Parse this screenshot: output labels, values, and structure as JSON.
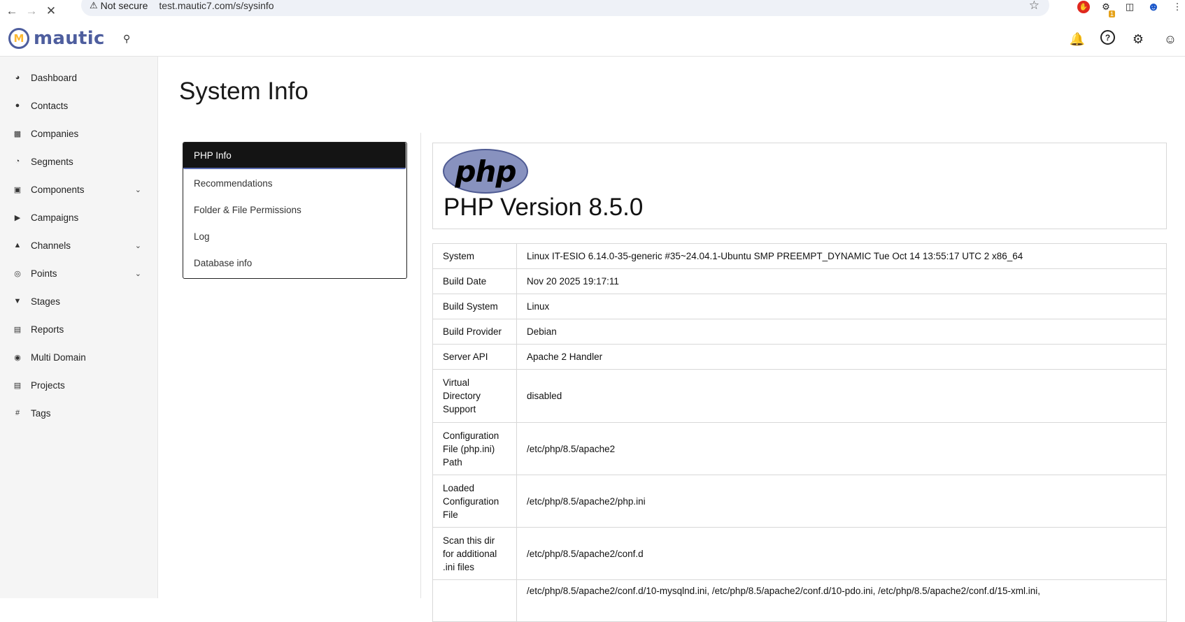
{
  "browser": {
    "security_label": "Not secure",
    "url": "test.mautic7.com/s/sysinfo",
    "ext_badge": "1"
  },
  "header": {
    "logo_text": "mautic",
    "logo_mark": "M"
  },
  "sidebar": {
    "items": [
      {
        "label": "Dashboard",
        "icon": "dashboard-icon"
      },
      {
        "label": "Contacts",
        "icon": "user-icon"
      },
      {
        "label": "Companies",
        "icon": "building-icon"
      },
      {
        "label": "Segments",
        "icon": "pie-chart-icon"
      },
      {
        "label": "Components",
        "icon": "archive-icon",
        "expandable": true
      },
      {
        "label": "Campaigns",
        "icon": "megaphone-icon"
      },
      {
        "label": "Channels",
        "icon": "broadcast-icon",
        "expandable": true
      },
      {
        "label": "Points",
        "icon": "coins-icon",
        "expandable": true
      },
      {
        "label": "Stages",
        "icon": "filter-icon"
      },
      {
        "label": "Reports",
        "icon": "report-icon"
      },
      {
        "label": "Multi Domain",
        "icon": "globe-icon"
      },
      {
        "label": "Projects",
        "icon": "box-icon"
      },
      {
        "label": "Tags",
        "icon": "hash-icon"
      }
    ]
  },
  "main": {
    "title": "System Info",
    "tabs": [
      {
        "label": "PHP Info",
        "active": true
      },
      {
        "label": "Recommendations"
      },
      {
        "label": "Folder & File Permissions"
      },
      {
        "label": "Log"
      },
      {
        "label": "Database info"
      }
    ],
    "php": {
      "logo_text": "php",
      "version": "PHP Version 8.5.0"
    },
    "info_rows": [
      {
        "key": "System",
        "value": "Linux IT-ESIO 6.14.0-35-generic #35~24.04.1-Ubuntu SMP PREEMPT_DYNAMIC Tue Oct 14 13:55:17 UTC 2 x86_64"
      },
      {
        "key": "Build Date",
        "value": "Nov 20 2025 19:17:11"
      },
      {
        "key": "Build System",
        "value": "Linux"
      },
      {
        "key": "Build Provider",
        "value": "Debian"
      },
      {
        "key": "Server API",
        "value": "Apache 2 Handler"
      },
      {
        "key": "Virtual Directory Support",
        "value": "disabled"
      },
      {
        "key": "Configuration File (php.ini) Path",
        "value": "/etc/php/8.5/apache2"
      },
      {
        "key": "Loaded Configuration File",
        "value": "/etc/php/8.5/apache2/php.ini"
      },
      {
        "key": "Scan this dir for additional .ini files",
        "value": "/etc/php/8.5/apache2/conf.d"
      },
      {
        "key": "",
        "value": "/etc/php/8.5/apache2/conf.d/10-mysqlnd.ini, /etc/php/8.5/apache2/conf.d/10-pdo.ini, /etc/php/8.5/apache2/conf.d/15-xml.ini,"
      }
    ]
  }
}
